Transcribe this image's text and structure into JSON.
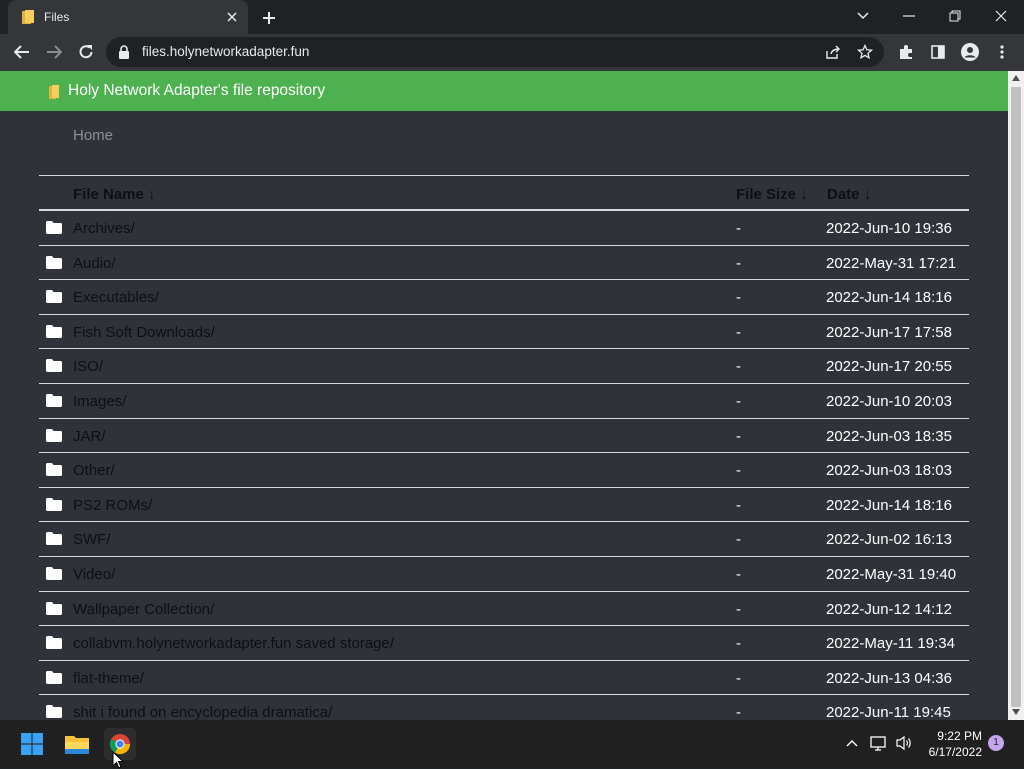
{
  "browser": {
    "tab_title": "Files",
    "url": "files.holynetworkadapter.fun"
  },
  "site": {
    "header_title": "Holy Network Adapter's file repository",
    "breadcrumb": "Home",
    "header_color": "#4db150"
  },
  "table": {
    "columns": [
      "File Name ↓",
      "File Size ↓",
      "Date ↓"
    ],
    "rows": [
      {
        "name": "Archives/",
        "size": "-",
        "date": "2022-Jun-10 19:36"
      },
      {
        "name": "Audio/",
        "size": "-",
        "date": "2022-May-31 17:21"
      },
      {
        "name": "Executables/",
        "size": "-",
        "date": "2022-Jun-14 18:16"
      },
      {
        "name": "Fish Soft Downloads/",
        "size": "-",
        "date": "2022-Jun-17 17:58"
      },
      {
        "name": "ISO/",
        "size": "-",
        "date": "2022-Jun-17 20:55"
      },
      {
        "name": "Images/",
        "size": "-",
        "date": "2022-Jun-10 20:03"
      },
      {
        "name": "JAR/",
        "size": "-",
        "date": "2022-Jun-03 18:35"
      },
      {
        "name": "Other/",
        "size": "-",
        "date": "2022-Jun-03 18:03"
      },
      {
        "name": "PS2 ROMs/",
        "size": "-",
        "date": "2022-Jun-14 18:16"
      },
      {
        "name": "SWF/",
        "size": "-",
        "date": "2022-Jun-02 16:13"
      },
      {
        "name": "Video/",
        "size": "-",
        "date": "2022-May-31 19:40"
      },
      {
        "name": "Wallpaper Collection/",
        "size": "-",
        "date": "2022-Jun-12 14:12"
      },
      {
        "name": "collabvm.holynetworkadapter.fun saved storage/",
        "size": "-",
        "date": "2022-May-11 19:34"
      },
      {
        "name": "flat-theme/",
        "size": "-",
        "date": "2022-Jun-13 04:36"
      },
      {
        "name": "shit i found on encyclopedia dramatica/",
        "size": "-",
        "date": "2022-Jun-11 19:45"
      }
    ]
  },
  "taskbar": {
    "time": "9:22 PM",
    "date": "6/17/2022",
    "notification_count": "1"
  }
}
